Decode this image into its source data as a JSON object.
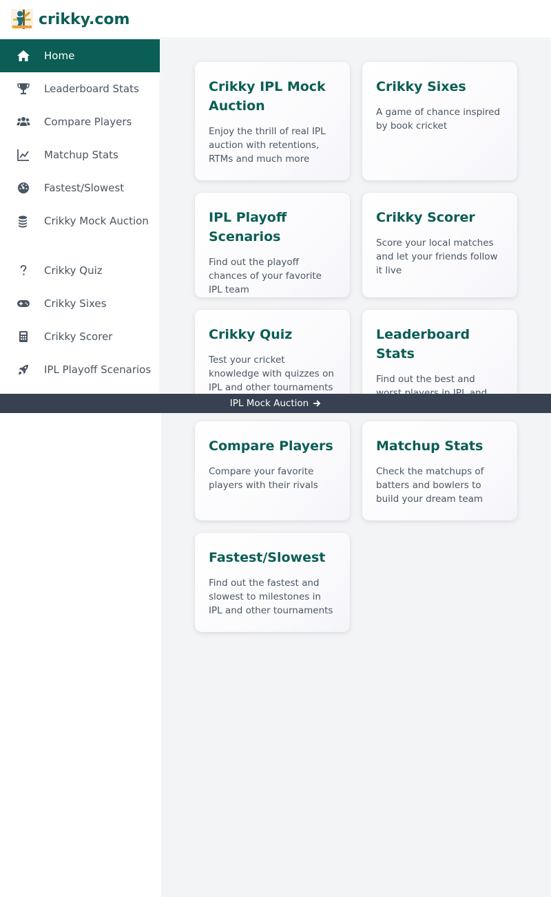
{
  "header": {
    "brand": "crikky.com",
    "logo_icon": "cricket-batter-logo"
  },
  "sidebar": {
    "items": [
      {
        "label": "Home",
        "icon": "home-icon",
        "active": true
      },
      {
        "label": "Leaderboard Stats",
        "icon": "trophy-icon"
      },
      {
        "label": "Compare Players",
        "icon": "users-icon"
      },
      {
        "label": "Matchup Stats",
        "icon": "line-chart-icon"
      },
      {
        "label": "Fastest/Slowest",
        "icon": "gauge-icon"
      },
      {
        "label": "Crikky Mock Auction",
        "icon": "coins-icon"
      },
      {
        "label": "Crikky Quiz",
        "icon": "question-icon"
      },
      {
        "label": "Crikky Sixes",
        "icon": "gamepad-icon"
      },
      {
        "label": "Crikky Scorer",
        "icon": "calculator-icon"
      },
      {
        "label": "IPL Playoff Scenarios",
        "icon": "rocket-icon"
      }
    ]
  },
  "cards": [
    {
      "title": "Crikky IPL Mock Auction",
      "desc": "Enjoy the thrill of real IPL auction with retentions, RTMs and much more"
    },
    {
      "title": "Crikky Sixes",
      "desc": "A game of chance inspired by book cricket"
    },
    {
      "title": "IPL Playoff Scenarios",
      "desc": "Find out the playoff chances of your favorite IPL team"
    },
    {
      "title": "Crikky Scorer",
      "desc": "Score your local matches and let your friends follow it live"
    },
    {
      "title": "Crikky Quiz",
      "desc": "Test your cricket knowledge with quizzes on IPL and other tournaments"
    },
    {
      "title": "Leaderboard Stats",
      "desc": "Find out the best and worst players in IPL and other tournaments"
    },
    {
      "title": "Compare Players",
      "desc": "Compare your favorite players with their rivals"
    },
    {
      "title": "Matchup Stats",
      "desc": "Check the matchups of batters and bowlers to build your dream team"
    },
    {
      "title": "Fastest/Slowest",
      "desc": "Find out the fastest and slowest to milestones in IPL and other tournaments"
    }
  ],
  "banner": {
    "label": "IPL Mock Auction",
    "icon": "arrow-right-icon"
  },
  "colors": {
    "brand": "#0b5e55",
    "banner_bg": "#374151",
    "main_bg": "#f3f4f6"
  }
}
